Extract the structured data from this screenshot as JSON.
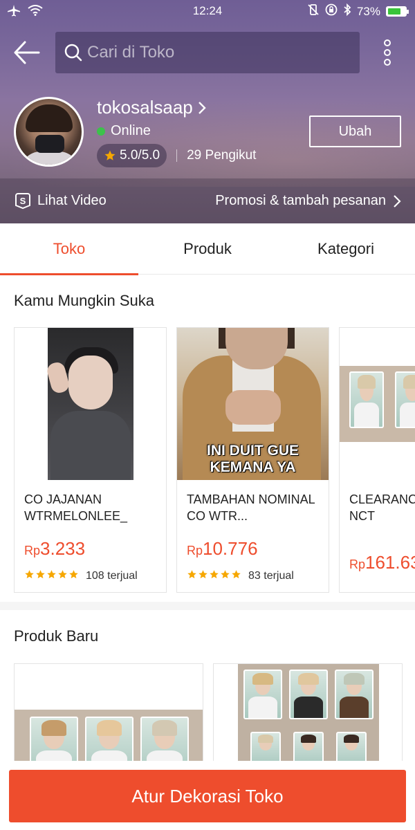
{
  "status_bar": {
    "time": "12:24",
    "battery": "73%",
    "battery_level": 0.73
  },
  "search": {
    "placeholder": "Cari di Toko"
  },
  "shop": {
    "name": "tokosalsaap",
    "status": "Online",
    "rating": "5.0/5.0",
    "followers": "29 Pengikut",
    "edit_label": "Ubah"
  },
  "video_strip": {
    "video_label": "Lihat Video",
    "promo_label": "Promosi & tambah pesanan"
  },
  "tabs": [
    {
      "label": "Toko",
      "active": true
    },
    {
      "label": "Produk",
      "active": false
    },
    {
      "label": "Kategori",
      "active": false
    }
  ],
  "recommend": {
    "title": "Kamu Mungkin Suka",
    "items": [
      {
        "name": "CO JAJANAN WTRMELONLEE_",
        "currency": "Rp",
        "price": "3.233",
        "sold": "108 terjual",
        "stars": 5
      },
      {
        "name": "TAMBAHAN NOMINAL CO WTR...",
        "caption_line1": "INI DUIT GUE",
        "caption_line2": "KEMANA YA",
        "currency": "Rp",
        "price": "10.776",
        "sold": "83 terjual",
        "stars": 5
      },
      {
        "name": "CLEARANC NCT",
        "currency": "Rp",
        "price": "161.63"
      }
    ]
  },
  "new_products": {
    "title": "Produk Baru"
  },
  "cta": {
    "label": "Atur Dekorasi Toko"
  },
  "colors": {
    "accent": "#ee4d2d",
    "online": "#3cc24b",
    "star": "#f6a700",
    "header_purple": "#7a689b"
  }
}
